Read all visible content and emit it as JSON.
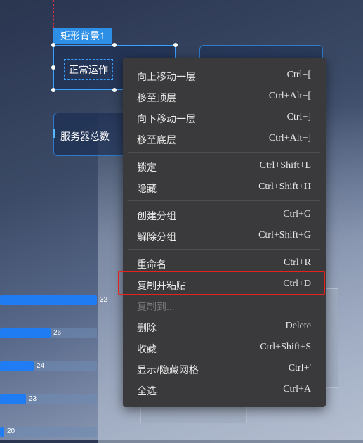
{
  "canvas": {
    "selected_tag": "矩形背景1",
    "selected_text": "正常运作",
    "card_label": "服务器总数"
  },
  "bars": [
    {
      "value": 32,
      "label": "32",
      "fraction": 1.0
    },
    {
      "value": 26,
      "label": "26",
      "fraction": 0.52
    },
    {
      "value": 24,
      "label": "24",
      "fraction": 0.35
    },
    {
      "value": 23,
      "label": "23",
      "fraction": 0.27
    },
    {
      "value": 20,
      "label": "20",
      "fraction": 0.0
    }
  ],
  "menu": {
    "items": [
      {
        "label": "向上移动一层",
        "shortcut": "Ctrl+["
      },
      {
        "label": "移至顶层",
        "shortcut": "Ctrl+Alt+["
      },
      {
        "label": "向下移动一层",
        "shortcut": "Ctrl+]"
      },
      {
        "label": "移至底层",
        "shortcut": "Ctrl+Alt+]"
      },
      {
        "label": "锁定",
        "shortcut": "Ctrl+Shift+L"
      },
      {
        "label": "隐藏",
        "shortcut": "Ctrl+Shift+H"
      },
      {
        "label": "创建分组",
        "shortcut": "Ctrl+G"
      },
      {
        "label": "解除分组",
        "shortcut": "Ctrl+Shift+G"
      },
      {
        "label": "重命名",
        "shortcut": "Ctrl+R"
      },
      {
        "label": "复制并粘贴",
        "shortcut": "Ctrl+D"
      },
      {
        "label": "复制到...",
        "shortcut": ""
      },
      {
        "label": "删除",
        "shortcut": "Delete"
      },
      {
        "label": "收藏",
        "shortcut": "Ctrl+Shift+S"
      },
      {
        "label": "显示/隐藏网格",
        "shortcut": "Ctrl+'"
      },
      {
        "label": "全选",
        "shortcut": "Ctrl+A"
      }
    ]
  },
  "colors": {
    "menu_bg": "#3a3a3c",
    "highlight_border": "#e5231c",
    "accent": "#2e8fe6"
  }
}
